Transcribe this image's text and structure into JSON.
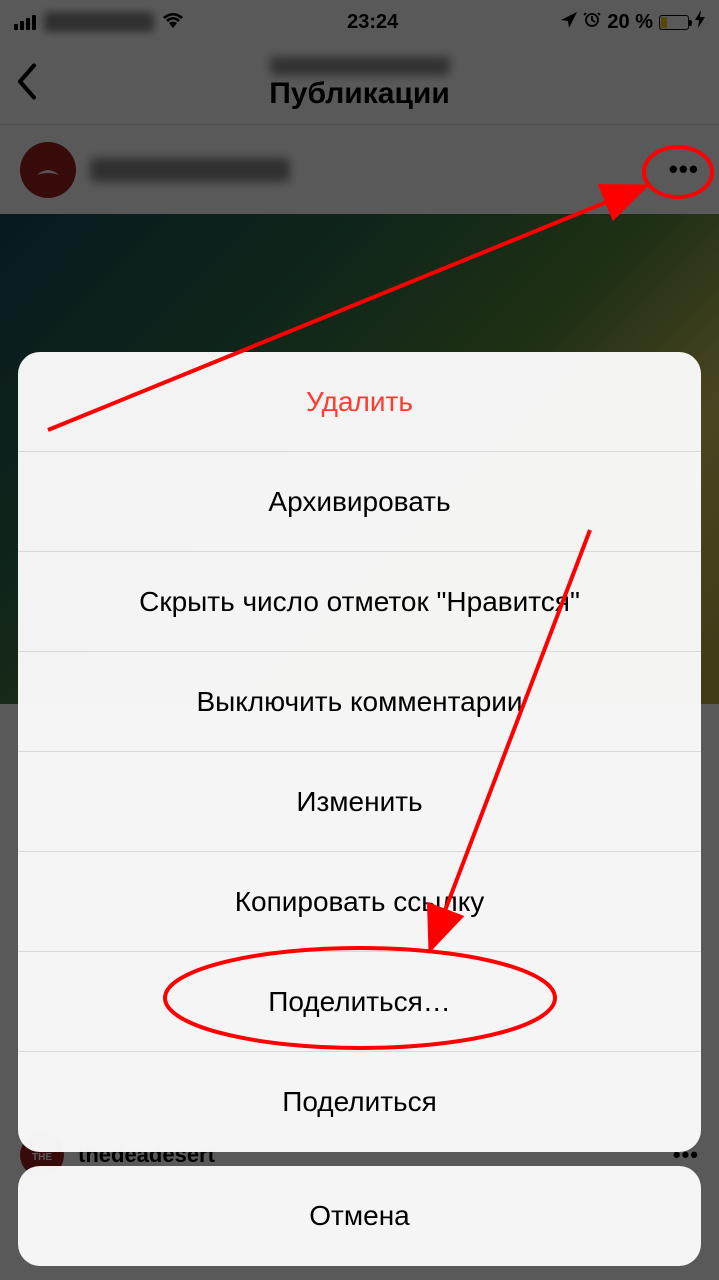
{
  "status_bar": {
    "time": "23:24",
    "battery_percent": "20 %"
  },
  "header": {
    "title": "Публикации"
  },
  "post": {
    "username": "thedeadesert"
  },
  "action_sheet": {
    "delete": "Удалить",
    "archive": "Архивировать",
    "hide_likes": "Скрыть число отметок \"Нравится\"",
    "turn_off_comments": "Выключить комментарии",
    "edit": "Изменить",
    "copy_link": "Копировать ссылку",
    "share_to": "Поделиться…",
    "share": "Поделиться",
    "cancel": "Отмена"
  }
}
